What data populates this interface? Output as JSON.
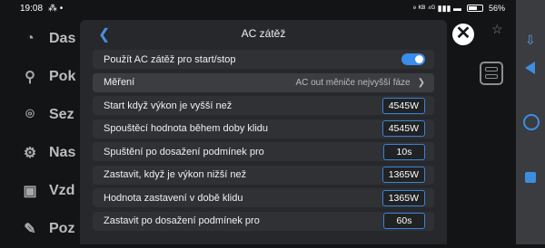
{
  "status_bar": {
    "time": "19:08",
    "left_icons": "⁂ •",
    "right_icons": "⁹ ᴷᴮ ⁴ᴳ ▮▮▮ ▬",
    "battery": "56%"
  },
  "background": {
    "sidebar": [
      {
        "label": "Das",
        "icon": "dashboard-icon"
      },
      {
        "label": "Pok",
        "icon": "share-icon"
      },
      {
        "label": "Sez",
        "icon": "location-icon"
      },
      {
        "label": "Nas",
        "icon": "gear-icon"
      },
      {
        "label": "Vzd",
        "icon": "backup-icon"
      },
      {
        "label": "Poz",
        "icon": "edit-icon"
      }
    ]
  },
  "dialog": {
    "title": "AC zátěž",
    "rows": [
      {
        "label": "Použít AC zátěž pro start/stop",
        "type": "toggle",
        "on": true
      },
      {
        "label": "Měření",
        "type": "select",
        "value": "AC out měniče nejvyšší fáze"
      },
      {
        "label": "Start když výkon je vyšší než",
        "type": "value",
        "value": "4545W"
      },
      {
        "label": "Spouštěcí hodnota během doby klidu",
        "type": "value",
        "value": "4545W"
      },
      {
        "label": "Spuštění po dosažení podmínek pro",
        "type": "value",
        "value": "10s"
      },
      {
        "label": "Zastavit, když je výkon nižší než",
        "type": "value",
        "value": "1365W"
      },
      {
        "label": "Hodnota zastavení v době klidu",
        "type": "value",
        "value": "1365W"
      },
      {
        "label": "Zastavit po dosažení podmínek pro",
        "type": "value",
        "value": "60s"
      }
    ]
  },
  "icons": {
    "close": "✕",
    "back": "❮",
    "chevron": "❯",
    "star": "☆"
  },
  "colors": {
    "accent": "#3b82d6",
    "dialog_bg": "#26282b",
    "row_bg": "#2f3135"
  }
}
